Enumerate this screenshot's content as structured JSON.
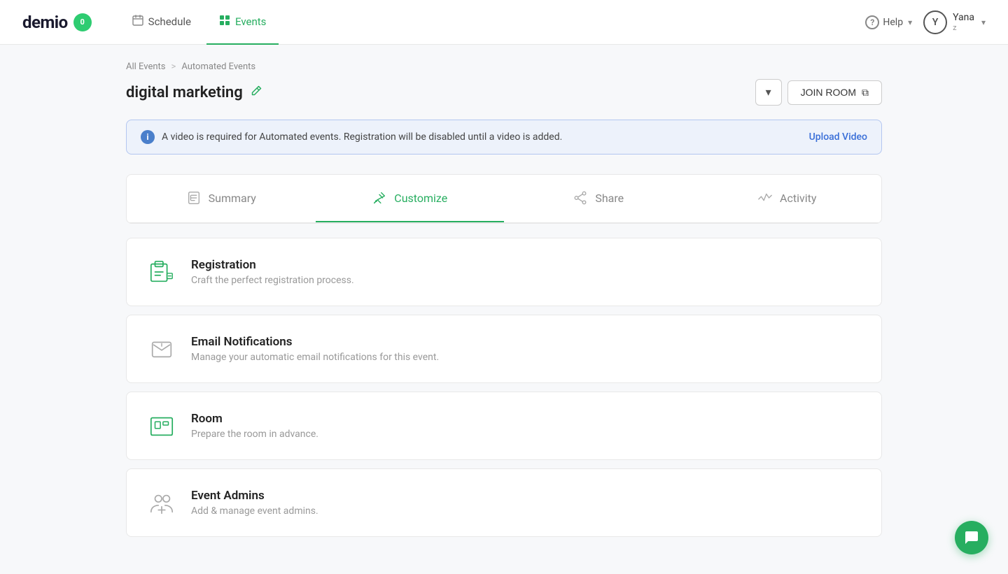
{
  "app": {
    "logo_text": "demio",
    "logo_badge": "0"
  },
  "navbar": {
    "schedule_label": "Schedule",
    "events_label": "Events",
    "help_label": "Help",
    "user_name": "Yana",
    "user_sub": "z",
    "user_initial": "Y"
  },
  "breadcrumb": {
    "all_events": "All Events",
    "separator": ">",
    "current": "Automated Events"
  },
  "page": {
    "title": "digital marketing",
    "dropdown_icon": "▾",
    "join_room_label": "JOIN ROOM",
    "join_room_icon": "⧉"
  },
  "alert": {
    "text": "A video is required for Automated events. Registration will be disabled until a video is added.",
    "action": "Upload Video"
  },
  "tabs": [
    {
      "id": "summary",
      "label": "Summary",
      "active": false
    },
    {
      "id": "customize",
      "label": "Customize",
      "active": true
    },
    {
      "id": "share",
      "label": "Share",
      "active": false
    },
    {
      "id": "activity",
      "label": "Activity",
      "active": false
    }
  ],
  "cards": [
    {
      "id": "registration",
      "title": "Registration",
      "description": "Craft the perfect registration process."
    },
    {
      "id": "email-notifications",
      "title": "Email Notifications",
      "description": "Manage your automatic email notifications for this event."
    },
    {
      "id": "room",
      "title": "Room",
      "description": "Prepare the room in advance."
    },
    {
      "id": "event-admins",
      "title": "Event Admins",
      "description": "Add & manage event admins."
    }
  ]
}
